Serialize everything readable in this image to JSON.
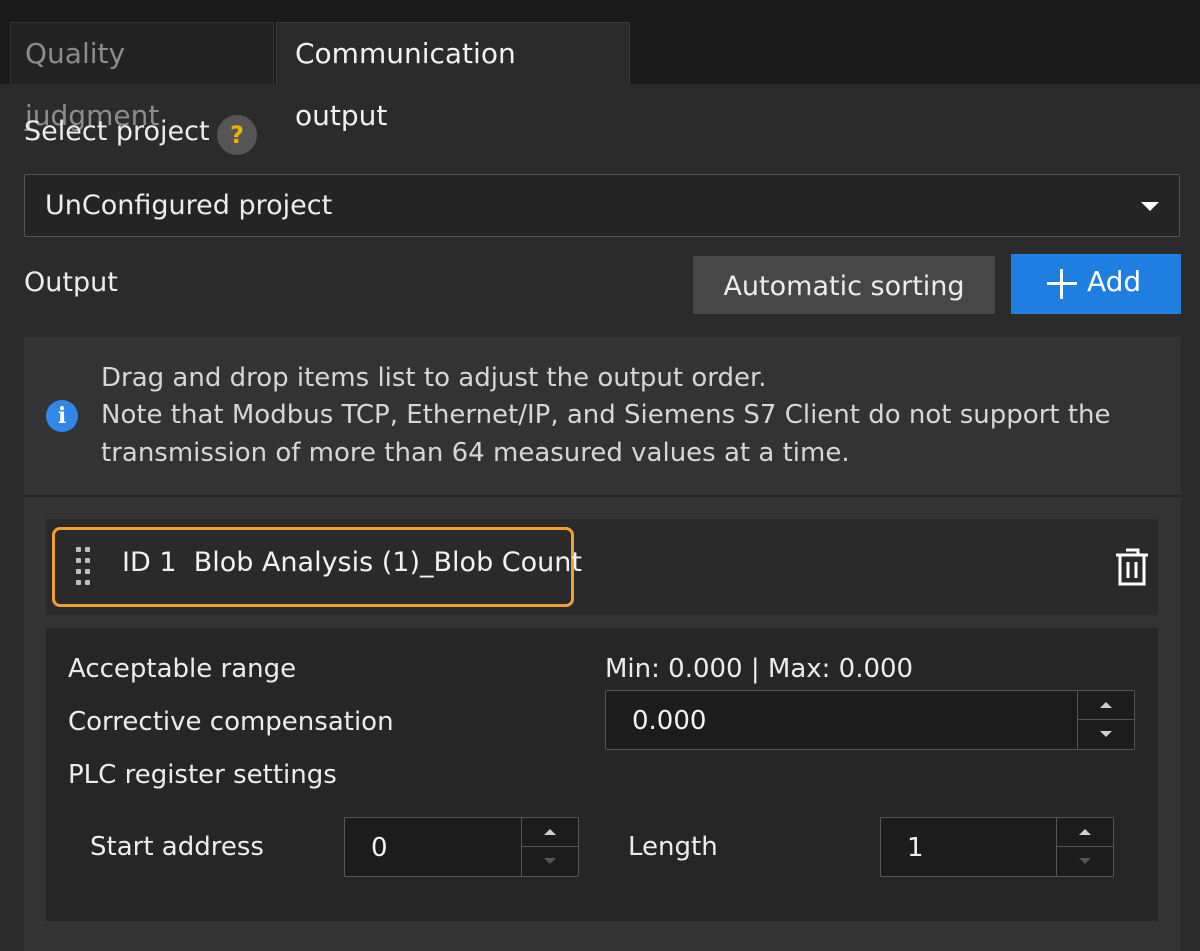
{
  "tabs": [
    {
      "label": "Quality judgment",
      "active": false
    },
    {
      "label": "Communication output",
      "active": true
    }
  ],
  "select_project": {
    "label": "Select project",
    "help_icon": "?",
    "value": "UnConfigured project"
  },
  "output": {
    "label": "Output",
    "sort_button": "Automatic sorting",
    "add_button": "Add",
    "info_lines": [
      "Drag and drop items list to adjust the output order.",
      "Note that Modbus TCP, Ethernet/IP, and Siemens S7 Client do not support the",
      "transmission of more than 64 measured values at a time."
    ],
    "info_icon": "i"
  },
  "item": {
    "id": "ID 1",
    "name": "Blob Analysis (1)_Blob Count",
    "acceptable_range_label": "Acceptable range",
    "acceptable_range_value": "Min: 0.000 | Max: 0.000",
    "compensation_label": "Corrective compensation",
    "compensation_value": "0.000",
    "plc_label": "PLC register settings",
    "start_address_label": "Start address",
    "start_address_value": "0",
    "length_label": "Length",
    "length_value": "1"
  },
  "colors": {
    "accent": "#1e7fe0",
    "highlight": "#f0a030",
    "help": "#f0b000"
  }
}
